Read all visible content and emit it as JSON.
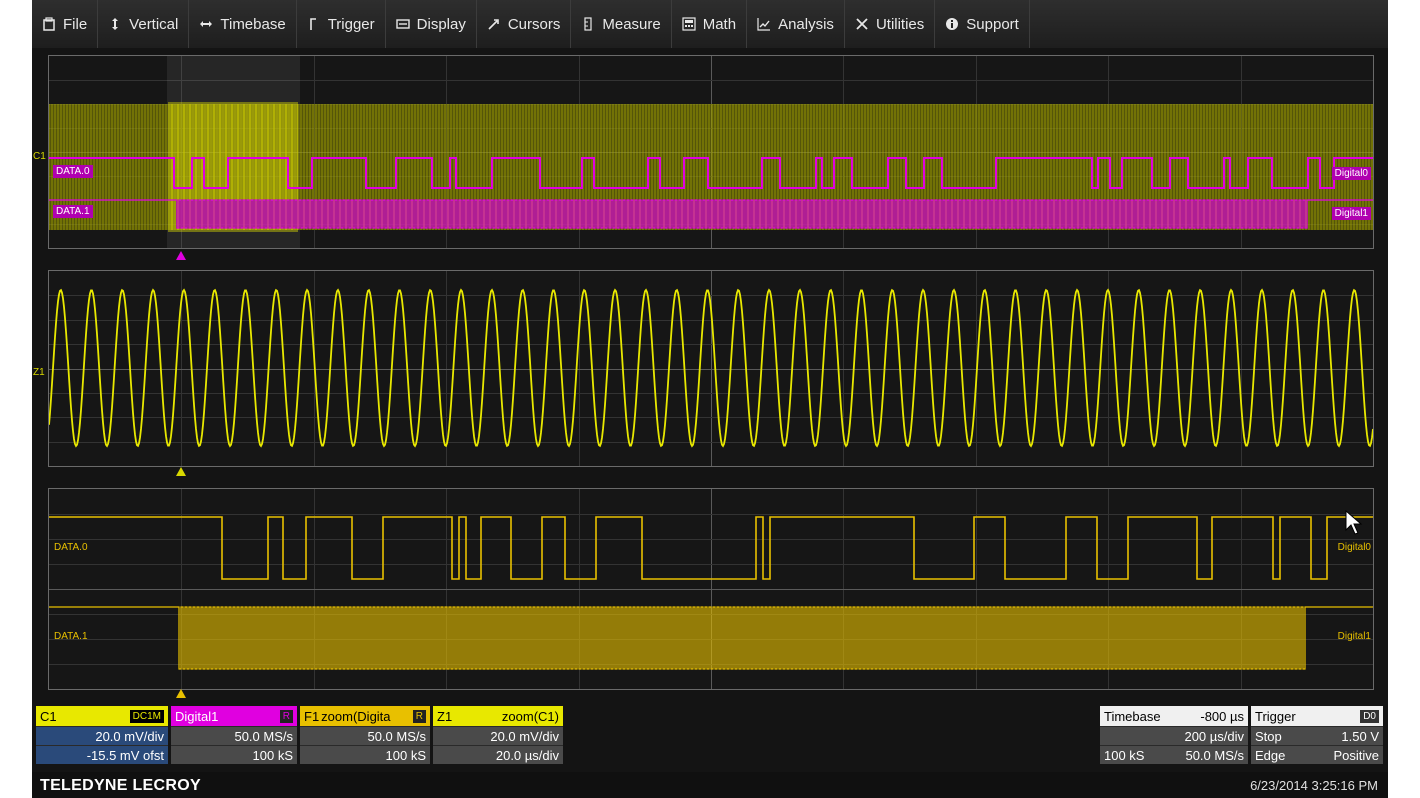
{
  "menu": [
    {
      "label": "File",
      "icon": "file-icon"
    },
    {
      "label": "Vertical",
      "icon": "vertical-icon"
    },
    {
      "label": "Timebase",
      "icon": "timebase-icon"
    },
    {
      "label": "Trigger",
      "icon": "trigger-icon"
    },
    {
      "label": "Display",
      "icon": "display-icon"
    },
    {
      "label": "Cursors",
      "icon": "cursors-icon"
    },
    {
      "label": "Measure",
      "icon": "measure-icon"
    },
    {
      "label": "Math",
      "icon": "math-icon"
    },
    {
      "label": "Analysis",
      "icon": "analysis-icon"
    },
    {
      "label": "Utilities",
      "icon": "utilities-icon"
    },
    {
      "label": "Support",
      "icon": "support-icon"
    }
  ],
  "grid1": {
    "channel": "C1",
    "lane0": "DATA.0",
    "lane1": "DATA.1",
    "right0": "Digital0",
    "right1": "Digital1"
  },
  "grid2": {
    "channel": "Z1"
  },
  "grid3": {
    "lane0": "DATA.0",
    "lane1": "DATA.1",
    "right0": "Digital0",
    "right1": "Digital1"
  },
  "colors": {
    "c1": "#d8d800",
    "digital": "#e000e0",
    "zoom": "#e8c000",
    "grid": "#6a6a6a",
    "background": "#141414"
  },
  "descriptors": {
    "c1": {
      "name": "C1",
      "tag": "DC1M",
      "vdiv": "20.0 mV/div",
      "offset": "-15.5 mV ofst"
    },
    "digital1": {
      "name": "Digital1",
      "tag": "R",
      "rate": "50.0 MS/s",
      "samples": "100 kS"
    },
    "f1": {
      "name": "F1",
      "source": "zoom(Digita",
      "tag": "R",
      "rate": "50.0 MS/s",
      "samples": "100 kS"
    },
    "z1": {
      "name": "Z1",
      "source": "zoom(C1)",
      "vdiv": "20.0 mV/div",
      "tdiv": "20.0 µs/div"
    }
  },
  "timebase": {
    "label": "Timebase",
    "delay": "-800 µs",
    "tdiv": "200 µs/div",
    "samples": "100 kS",
    "rate": "50.0 MS/s"
  },
  "trigger": {
    "label": "Trigger",
    "source": "D0",
    "mode": "Stop",
    "level": "1.50 V",
    "type": "Edge",
    "slope": "Positive"
  },
  "footer": {
    "brand": "TELEDYNE LECROY",
    "datetime": "6/23/2014 3:25:16 PM"
  }
}
